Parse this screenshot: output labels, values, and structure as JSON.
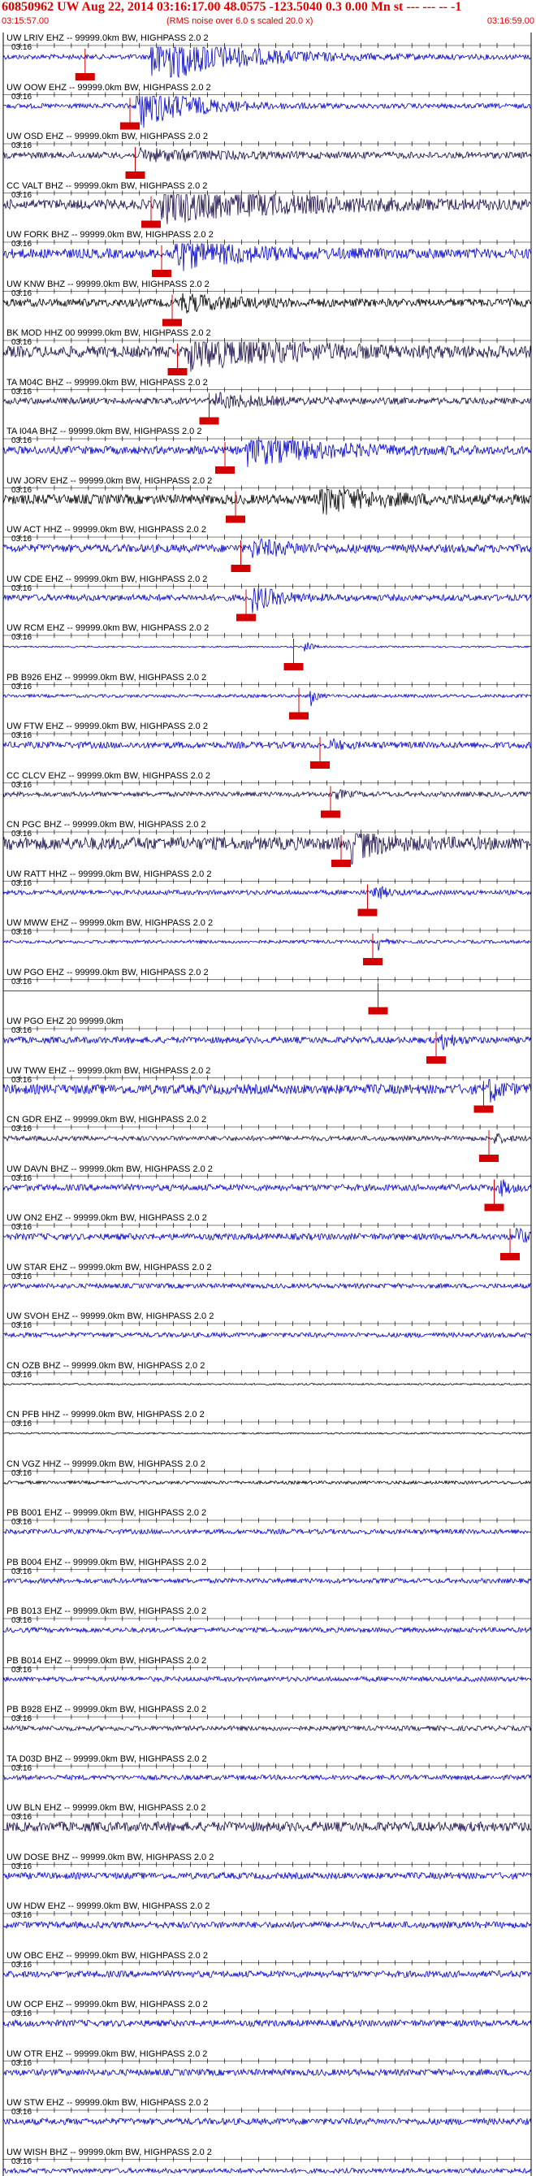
{
  "header": {
    "title": "60850962 UW Aug 22, 2014 03:16:17.00   48.0575 -123.5040  0.3 0.00 Mn st --- --- --  -1",
    "start_time": "03:15:57.00",
    "note": "(RMS noise over 6.0 s scaled 20.0 x)",
    "end_time": "03:16:59.00"
  },
  "colors": {
    "header_red": "#e00000",
    "pick_red": "#d40000",
    "trace_blue": "#0000cc",
    "trace_dark": "#1a0a4a",
    "trace_black": "#000000"
  },
  "traces": [
    {
      "label": "UW LRIV EHZ -- 99999.0km BW, HIGHPASS  2.0  2",
      "time": "03:16",
      "color": "#0000cc",
      "amp": 3,
      "event": 0.28,
      "evamp": 34,
      "evlen": 0.3,
      "pick": 0.155
    },
    {
      "label": "UW OOW EHZ -- 99999.0km BW, HIGHPASS  2.0  2",
      "time": "03:16",
      "color": "#0000cc",
      "amp": 3,
      "event": 0.25,
      "evamp": 30,
      "evlen": 0.2,
      "pick": 0.24
    },
    {
      "label": "UW OSD EHZ -- 99999.0km BW, HIGHPASS  2.0  2",
      "time": "03:16",
      "color": "#1a0a4a",
      "amp": 4,
      "event": 0.26,
      "evamp": 6,
      "evlen": 0.3,
      "pick": 0.25
    },
    {
      "label": "CC VALT BHZ -- 99999.0km BW, HIGHPASS  2.0  2",
      "time": "03:16",
      "color": "#1a0a4a",
      "amp": 6,
      "event": 0.3,
      "evamp": 20,
      "evlen": 0.5,
      "pick": 0.28
    },
    {
      "label": "UW FORK BHZ -- 99999.0km BW, HIGHPASS  2.0  2",
      "time": "03:16",
      "color": "#0000cc",
      "amp": 6,
      "event": 0.32,
      "evamp": 20,
      "evlen": 0.25,
      "pick": 0.3
    },
    {
      "label": "UW KNW BHZ -- 99999.0km BW, HIGHPASS  2.0  2",
      "time": "03:16",
      "color": "#000000",
      "amp": 5,
      "event": 0.33,
      "evamp": 10,
      "evlen": 0.2,
      "pick": 0.32
    },
    {
      "label": "BK MOD HHZ 00 99999.0km BW, HIGHPASS  2.0  2",
      "time": "03:16",
      "color": "#1a0a4a",
      "amp": 7,
      "event": 0.35,
      "evamp": 18,
      "evlen": 0.4,
      "pick": 0.33
    },
    {
      "label": "TA M04C BHZ -- 99999.0km BW, HIGHPASS  2.0  2",
      "time": "03:16",
      "color": "#1a0a4a",
      "amp": 4,
      "event": 0.4,
      "evamp": 8,
      "evlen": 0.2,
      "pick": 0.39
    },
    {
      "label": "TA I04A BHZ -- 99999.0km BW, HIGHPASS  2.0  2",
      "time": "03:16",
      "color": "#0000cc",
      "amp": 5,
      "event": 0.46,
      "evamp": 18,
      "evlen": 0.3,
      "pick": 0.42
    },
    {
      "label": "UW JORV EHZ -- 99999.0km BW, HIGHPASS  2.0  2",
      "time": "03:16",
      "color": "#000000",
      "amp": 6,
      "event": 0.6,
      "evamp": 16,
      "evlen": 0.2,
      "pick": 0.44
    },
    {
      "label": "UW ACT HHZ -- 99999.0km BW, HIGHPASS  2.0  2",
      "time": "03:16",
      "color": "#0000cc",
      "amp": 5,
      "event": 0.47,
      "evamp": 10,
      "evlen": 0.15,
      "pick": 0.45
    },
    {
      "label": "UW CDE EHZ -- 99999.0km BW, HIGHPASS  2.0  2",
      "time": "03:16",
      "color": "#0000cc",
      "amp": 4,
      "event": 0.47,
      "evamp": 16,
      "evlen": 0.1,
      "pick": 0.46
    },
    {
      "label": "UW RCM EHZ -- 99999.0km BW, HIGHPASS  2.0  2",
      "time": "03:16",
      "color": "#0000cc",
      "amp": 1,
      "event": 0.57,
      "evamp": 14,
      "evlen": 0.02,
      "pick": 0.55
    },
    {
      "label": "PB B926 EHZ -- 99999.0km BW, HIGHPASS  2.0  2",
      "time": "03:16",
      "color": "#0000cc",
      "amp": 2,
      "event": 0.58,
      "evamp": 16,
      "evlen": 0.02,
      "pick": 0.56
    },
    {
      "label": "UW FTW EHZ -- 99999.0km BW, HIGHPASS  2.0  2",
      "time": "03:16",
      "color": "#0000cc",
      "amp": 4,
      "event": 0.62,
      "evamp": 6,
      "evlen": 0.05,
      "pick": 0.6
    },
    {
      "label": "CC CLCV EHZ -- 99999.0km BW, HIGHPASS  2.0  2",
      "time": "03:16",
      "color": "#1a0a4a",
      "amp": 3,
      "event": 0.63,
      "evamp": 5,
      "evlen": 0.05,
      "pick": 0.62
    },
    {
      "label": "CN PGC BHZ -- 99999.0km BW, HIGHPASS  2.0  2",
      "time": "03:16",
      "color": "#1a0a4a",
      "amp": 8,
      "event": 0.66,
      "evamp": 20,
      "evlen": 0.1,
      "pick": 0.64
    },
    {
      "label": "UW RATT HHZ -- 99999.0km BW, HIGHPASS  2.0  2",
      "time": "03:16",
      "color": "#0000cc",
      "amp": 3,
      "event": 0.7,
      "evamp": 10,
      "evlen": 0.05,
      "pick": 0.69
    },
    {
      "label": "UW MWW EHZ -- 99999.0km BW, HIGHPASS  2.0  2",
      "time": "03:16",
      "color": "#0000cc",
      "amp": 2,
      "event": 0.71,
      "evamp": 10,
      "evlen": 0.02,
      "pick": 0.7
    },
    {
      "label": "UW PGO EHZ -- 99999.0km BW, HIGHPASS  2.0  2",
      "time": "03:16",
      "color": "#0000cc",
      "amp": 0,
      "event": 0.72,
      "evamp": 0,
      "evlen": 0.01,
      "pick": 0.71
    },
    {
      "label": "UW PGO EHZ 20 99999.0km",
      "time": "03:16",
      "color": "#0000cc",
      "amp": 4,
      "event": 0.83,
      "evamp": 10,
      "evlen": 0.05,
      "pick": 0.82
    },
    {
      "label": "UW TWW EHZ -- 99999.0km BW, HIGHPASS  2.0  2",
      "time": "03:16",
      "color": "#0000cc",
      "amp": 6,
      "event": 0.92,
      "evamp": 14,
      "evlen": 0.05,
      "pick": 0.91
    },
    {
      "label": "CN GDR EHZ -- 99999.0km BW, HIGHPASS  2.0  2",
      "time": "03:16",
      "color": "#1a0a4a",
      "amp": 3,
      "event": 0.93,
      "evamp": 6,
      "evlen": 0.04,
      "pick": 0.92
    },
    {
      "label": "UW DAVN BHZ -- 99999.0km BW, HIGHPASS  2.0  2",
      "time": "03:16",
      "color": "#0000cc",
      "amp": 4,
      "event": 0.94,
      "evamp": 10,
      "evlen": 0.04,
      "pick": 0.93
    },
    {
      "label": "UW ON2 EHZ -- 99999.0km BW, HIGHPASS  2.0  2",
      "time": "03:16",
      "color": "#0000cc",
      "amp": 4,
      "event": 0.97,
      "evamp": 16,
      "evlen": 0.03,
      "pick": 0.96
    },
    {
      "label": "UW STAR EHZ -- 99999.0km BW, HIGHPASS  2.0  2",
      "time": "03:16",
      "color": "#0000cc",
      "amp": 3,
      "event": null,
      "evamp": 0,
      "evlen": 0,
      "pick": null
    },
    {
      "label": "UW SVOH EHZ -- 99999.0km BW, HIGHPASS  2.0  2",
      "time": "03:16",
      "color": "#0000cc",
      "amp": 3,
      "event": null,
      "evamp": 0,
      "evlen": 0,
      "pick": null
    },
    {
      "label": "CN OZB BHZ -- 99999.0km BW, HIGHPASS  2.0  2",
      "time": "03:16",
      "color": "#000000",
      "amp": 1,
      "event": null,
      "evamp": 0,
      "evlen": 0,
      "pick": null
    },
    {
      "label": "CN PFB HHZ -- 99999.0km BW, HIGHPASS  2.0  2",
      "time": "03:16",
      "color": "#000000",
      "amp": 1,
      "event": null,
      "evamp": 0,
      "evlen": 0,
      "pick": null
    },
    {
      "label": "CN VGZ HHZ -- 99999.0km BW, HIGHPASS  2.0  2",
      "time": "03:16",
      "color": "#000000",
      "amp": 2,
      "event": null,
      "evamp": 0,
      "evlen": 0,
      "pick": null
    },
    {
      "label": "PB B001 EHZ -- 99999.0km BW, HIGHPASS  2.0  2",
      "time": "03:16",
      "color": "#0000cc",
      "amp": 3,
      "event": null,
      "evamp": 0,
      "evlen": 0,
      "pick": null
    },
    {
      "label": "PB B004 EHZ -- 99999.0km BW, HIGHPASS  2.0  2",
      "time": "03:16",
      "color": "#0000cc",
      "amp": 3,
      "event": null,
      "evamp": 0,
      "evlen": 0,
      "pick": null
    },
    {
      "label": "PB B013 EHZ -- 99999.0km BW, HIGHPASS  2.0  2",
      "time": "03:16",
      "color": "#0000cc",
      "amp": 3,
      "event": null,
      "evamp": 0,
      "evlen": 0,
      "pick": null
    },
    {
      "label": "PB B014 EHZ -- 99999.0km BW, HIGHPASS  2.0  2",
      "time": "03:16",
      "color": "#0000cc",
      "amp": 3,
      "event": null,
      "evamp": 0,
      "evlen": 0,
      "pick": null
    },
    {
      "label": "PB B928 EHZ -- 99999.0km BW, HIGHPASS  2.0  2",
      "time": "03:16",
      "color": "#1a0a4a",
      "amp": 3,
      "event": null,
      "evamp": 0,
      "evlen": 0,
      "pick": null
    },
    {
      "label": "TA D03D BHZ -- 99999.0km BW, HIGHPASS  2.0  2",
      "time": "03:16",
      "color": "#0000cc",
      "amp": 3,
      "event": null,
      "evamp": 0,
      "evlen": 0,
      "pick": null
    },
    {
      "label": "UW BLN EHZ -- 99999.0km BW, HIGHPASS  2.0  2",
      "time": "03:16",
      "color": "#1a0a4a",
      "amp": 6,
      "event": null,
      "evamp": 0,
      "evlen": 0,
      "pick": null
    },
    {
      "label": "UW DOSE BHZ -- 99999.0km BW, HIGHPASS  2.0  2",
      "time": "03:16",
      "color": "#0000cc",
      "amp": 4,
      "event": null,
      "evamp": 0,
      "evlen": 0,
      "pick": null
    },
    {
      "label": "UW HDW EHZ -- 99999.0km BW, HIGHPASS  2.0  2",
      "time": "03:16",
      "color": "#0000cc",
      "amp": 4,
      "event": null,
      "evamp": 0,
      "evlen": 0,
      "pick": null
    },
    {
      "label": "UW OBC EHZ -- 99999.0km BW, HIGHPASS  2.0  2",
      "time": "03:16",
      "color": "#0000cc",
      "amp": 4,
      "event": null,
      "evamp": 0,
      "evlen": 0,
      "pick": null
    },
    {
      "label": "UW OCP EHZ -- 99999.0km BW, HIGHPASS  2.0  2",
      "time": "03:16",
      "color": "#0000cc",
      "amp": 4,
      "event": null,
      "evamp": 0,
      "evlen": 0,
      "pick": null
    },
    {
      "label": "UW OTR EHZ -- 99999.0km BW, HIGHPASS  2.0  2",
      "time": "03:16",
      "color": "#0000cc",
      "amp": 4,
      "event": null,
      "evamp": 0,
      "evlen": 0,
      "pick": null
    },
    {
      "label": "UW STW EHZ -- 99999.0km BW, HIGHPASS  2.0  2",
      "time": "03:16",
      "color": "#0000cc",
      "amp": 4,
      "event": null,
      "evamp": 0,
      "evlen": 0,
      "pick": null
    },
    {
      "label": "UW WISH BHZ -- 99999.0km BW, HIGHPASS  2.0  2",
      "time": "03:16",
      "color": "#0000cc",
      "amp": 3,
      "event": null,
      "evamp": 0,
      "evlen": 0,
      "pick": null
    }
  ]
}
